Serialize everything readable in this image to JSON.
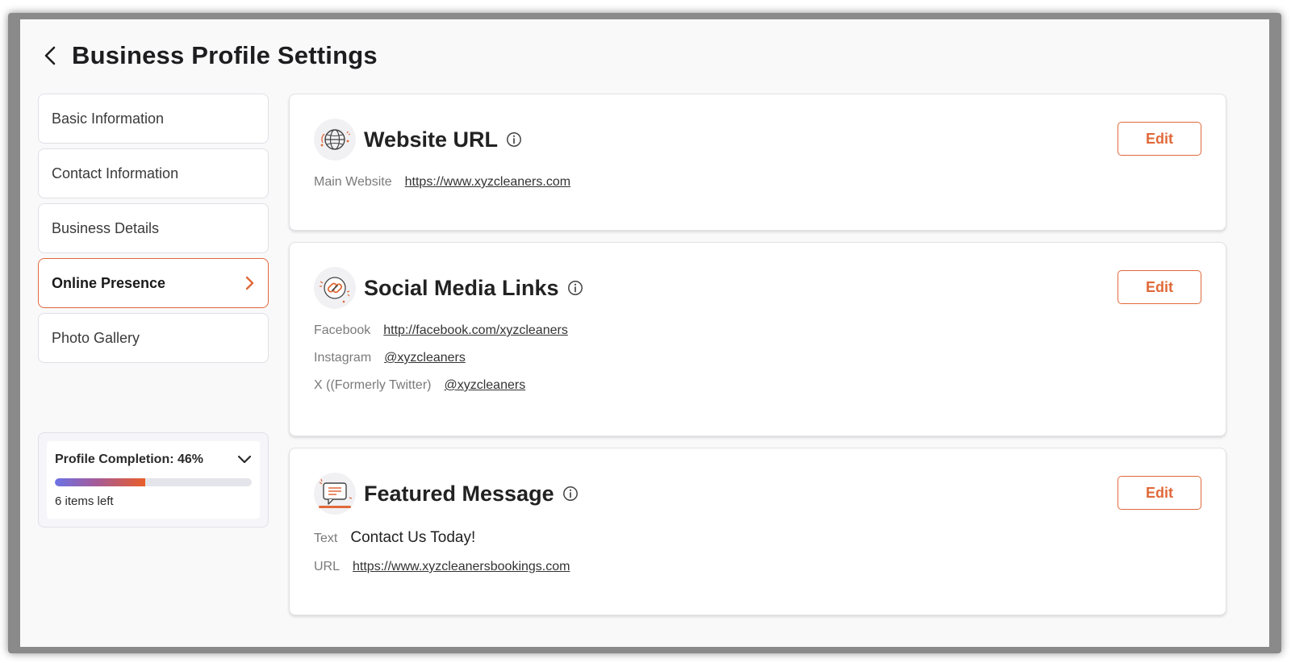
{
  "header": {
    "title": "Business Profile Settings"
  },
  "sidebar": {
    "items": [
      {
        "label": "Basic Information",
        "active": false
      },
      {
        "label": "Contact Information",
        "active": false
      },
      {
        "label": "Business Details",
        "active": false
      },
      {
        "label": "Online Presence",
        "active": true
      },
      {
        "label": "Photo Gallery",
        "active": false
      }
    ]
  },
  "completion": {
    "label": "Profile Completion: 46%",
    "percent": 46,
    "items_left": "6 items left"
  },
  "cards": {
    "website": {
      "title": "Website URL",
      "edit_label": "Edit",
      "rows": [
        {
          "label": "Main Website",
          "value": "https://www.xyzcleaners.com"
        }
      ]
    },
    "social": {
      "title": "Social Media Links",
      "edit_label": "Edit",
      "rows": [
        {
          "label": "Facebook",
          "value": "http://facebook.com/xyzcleaners"
        },
        {
          "label": "Instagram",
          "value": "@xyzcleaners"
        },
        {
          "label": "X ((Formerly Twitter)",
          "value": "@xyzcleaners"
        }
      ]
    },
    "featured": {
      "title": "Featured Message",
      "edit_label": "Edit",
      "rows": [
        {
          "label": "Text",
          "value": "Contact Us Today!"
        },
        {
          "label": "URL",
          "value": "https://www.xyzcleanersbookings.com"
        }
      ]
    }
  },
  "icons": {
    "back": "chevron-left-icon",
    "nav_active": "chevron-right-icon",
    "collapse": "chevron-down-icon",
    "info": "info-icon",
    "website": "globe-icon",
    "social": "link-icon",
    "featured": "chat-message-icon"
  },
  "colors": {
    "accent": "#e0693a",
    "progress_start": "#6b72e6",
    "progress_end": "#e85e2a"
  }
}
